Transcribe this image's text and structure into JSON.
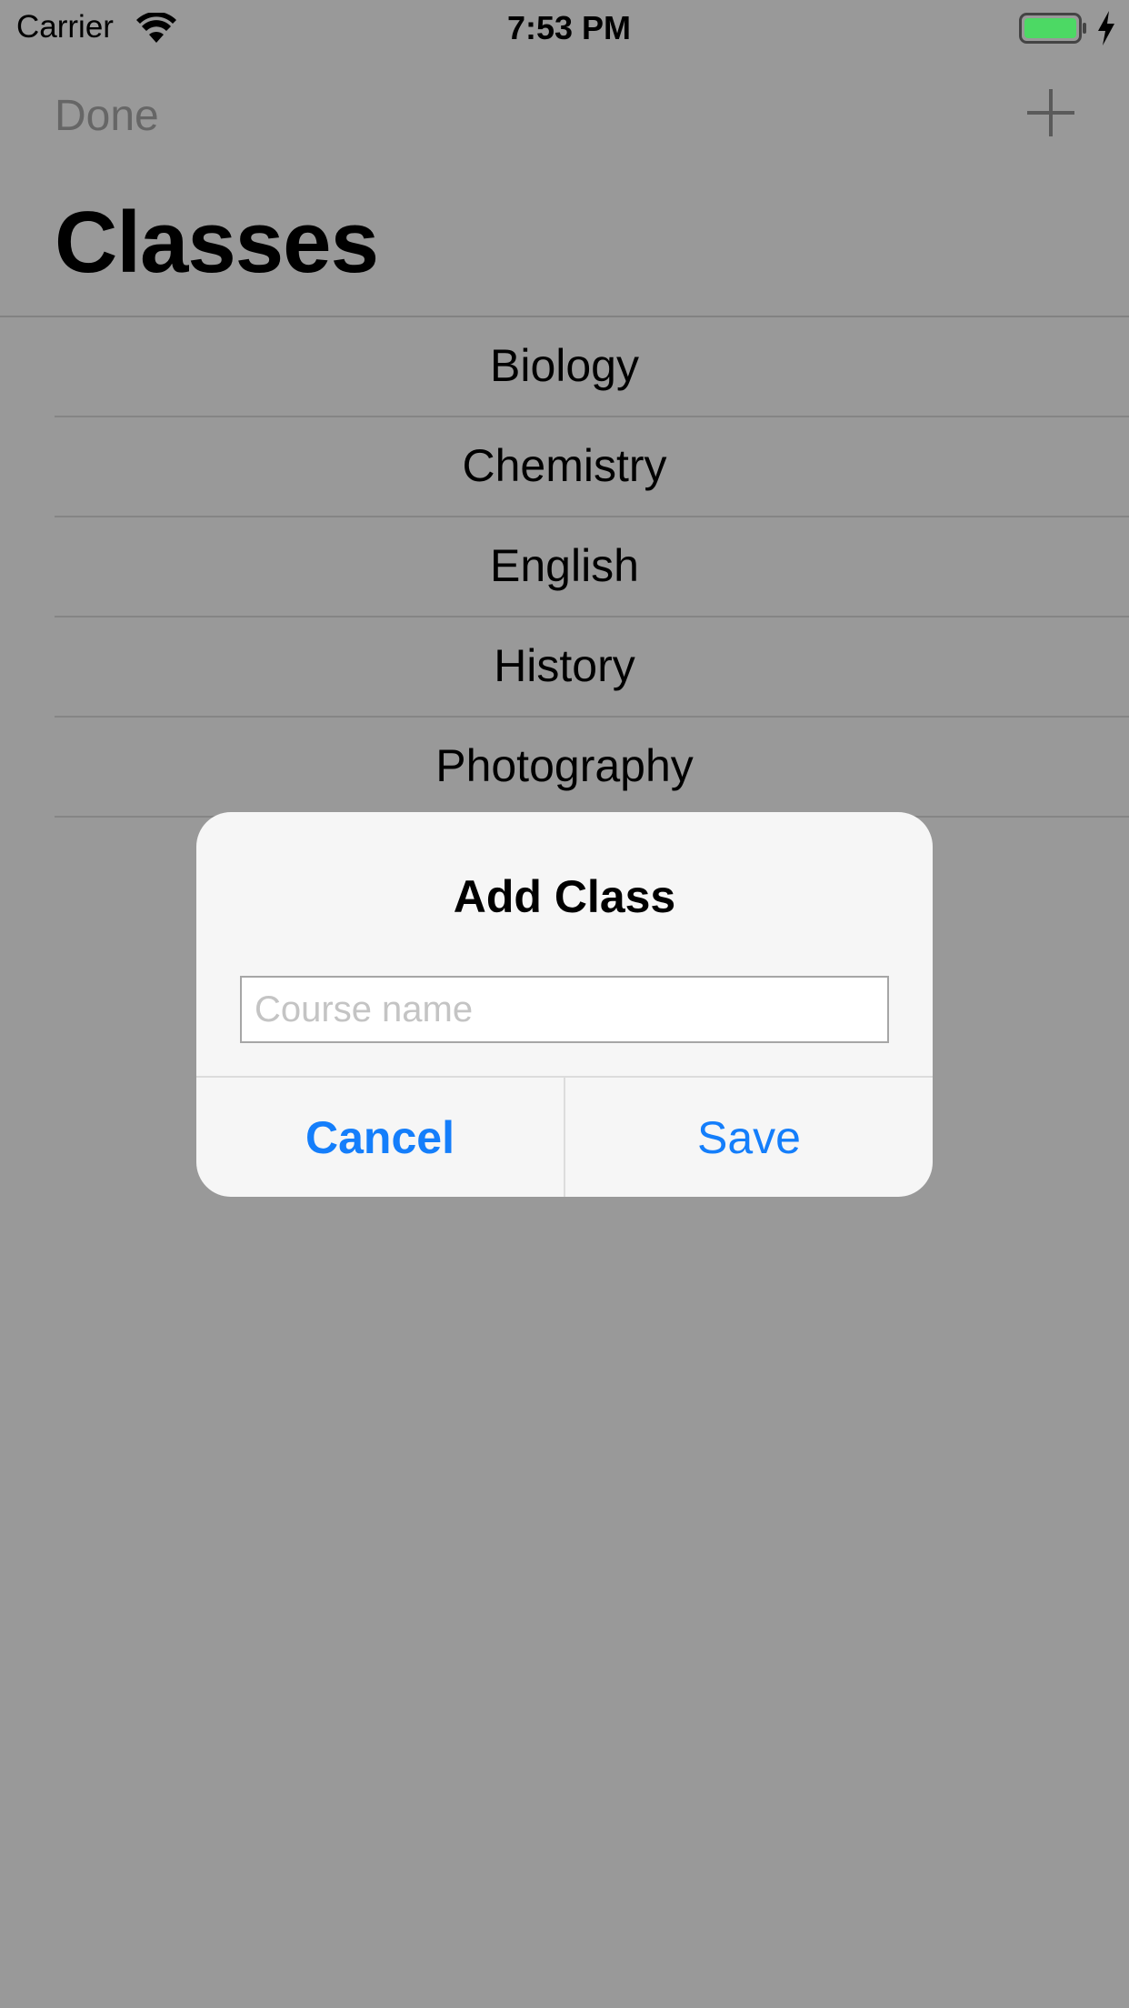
{
  "status_bar": {
    "carrier": "Carrier",
    "time": "7:53 PM",
    "wifi_icon": "wifi-icon",
    "battery_icon": "battery-charging-icon",
    "battery_color": "#4cd964"
  },
  "nav": {
    "done_label": "Done",
    "add_icon": "plus-icon",
    "title": "Classes"
  },
  "classes": [
    "Biology",
    "Chemistry",
    "English",
    "History",
    "Photography"
  ],
  "alert": {
    "title": "Add Class",
    "input_placeholder": "Course name",
    "input_value": "",
    "cancel_label": "Cancel",
    "save_label": "Save",
    "button_color": "#147efb"
  }
}
